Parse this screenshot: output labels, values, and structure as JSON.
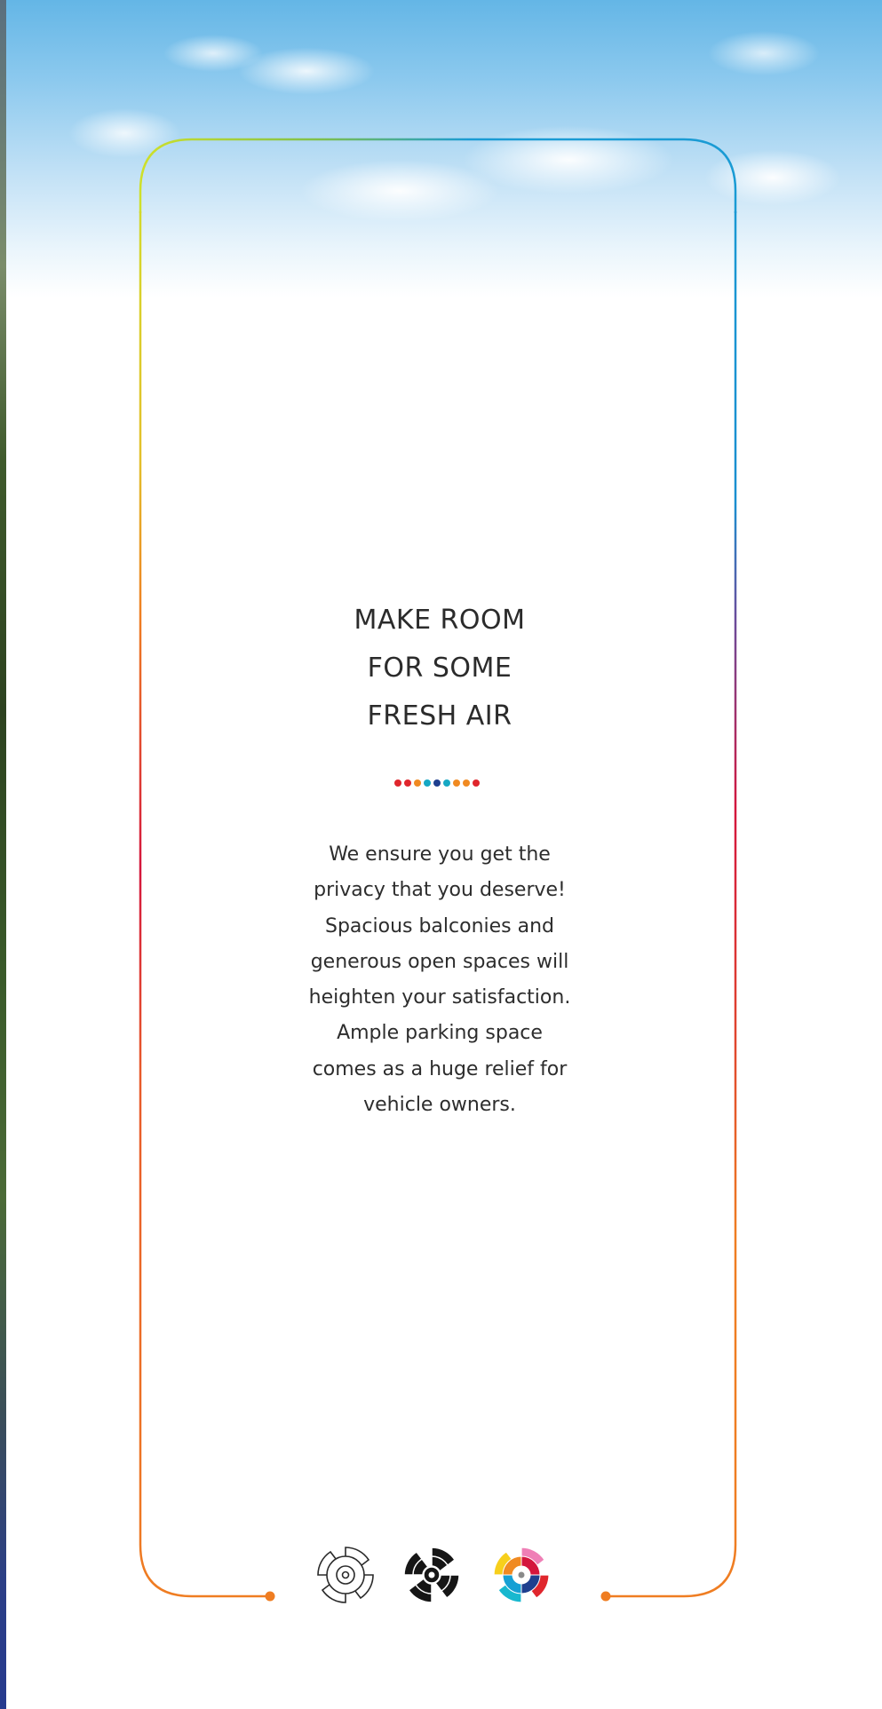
{
  "headline": {
    "lines": [
      "MAKE ROOM",
      "FOR SOME",
      "FRESH AIR"
    ]
  },
  "divider_dot_colors": [
    "#e0262d",
    "#e0262d",
    "#f08a22",
    "#16a8c4",
    "#1e3f8f",
    "#16a8c4",
    "#f08a22",
    "#f08a22",
    "#e0262d"
  ],
  "body": {
    "lines": [
      "We ensure you get the",
      "privacy that you deserve!",
      "Spacious balconies and",
      "generous open spaces will",
      "heighten your satisfaction.",
      "Ample parking space",
      "comes as a huge relief for",
      "vehicle owners."
    ]
  },
  "frame_colors": {
    "lime": "#cfe02a",
    "blue": "#1a9bd4",
    "purple": "#6a4b9b",
    "red": "#d4163d",
    "orange": "#ef7d22"
  },
  "icons": [
    "fan-outline-icon",
    "fan-solid-icon",
    "fan-color-icon"
  ]
}
